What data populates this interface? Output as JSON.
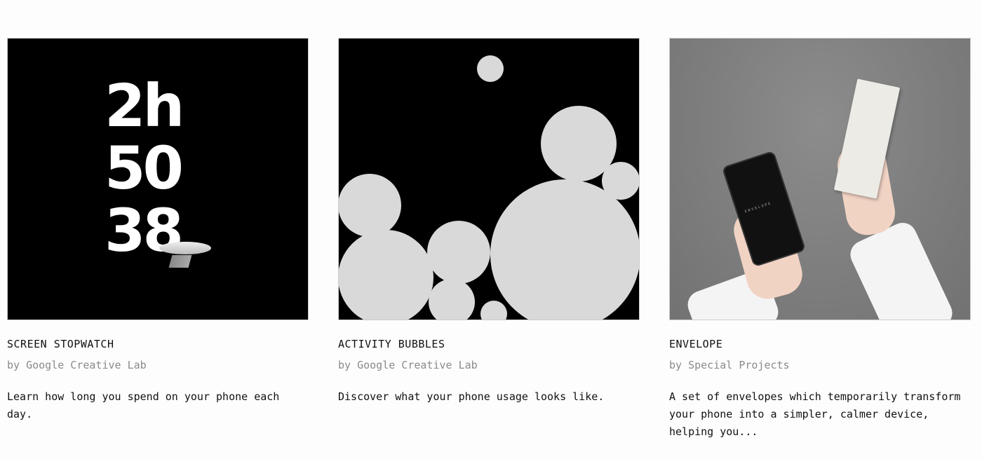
{
  "cards": [
    {
      "title": "SCREEN STOPWATCH",
      "author": "by Google Creative Lab",
      "description": "Learn how long you spend on your phone each day.",
      "image": {
        "digits": [
          "2h",
          "50",
          "38"
        ]
      }
    },
    {
      "title": "ACTIVITY BUBBLES",
      "author": "by Google Creative Lab",
      "description": "Discover what your phone usage looks like."
    },
    {
      "title": "ENVELOPE",
      "author": "by Special Projects",
      "description": "A set of envelopes which temporarily transform your phone into a simpler, calmer device, helping you...",
      "image": {
        "phone_text": "ENVELOPE"
      }
    }
  ]
}
